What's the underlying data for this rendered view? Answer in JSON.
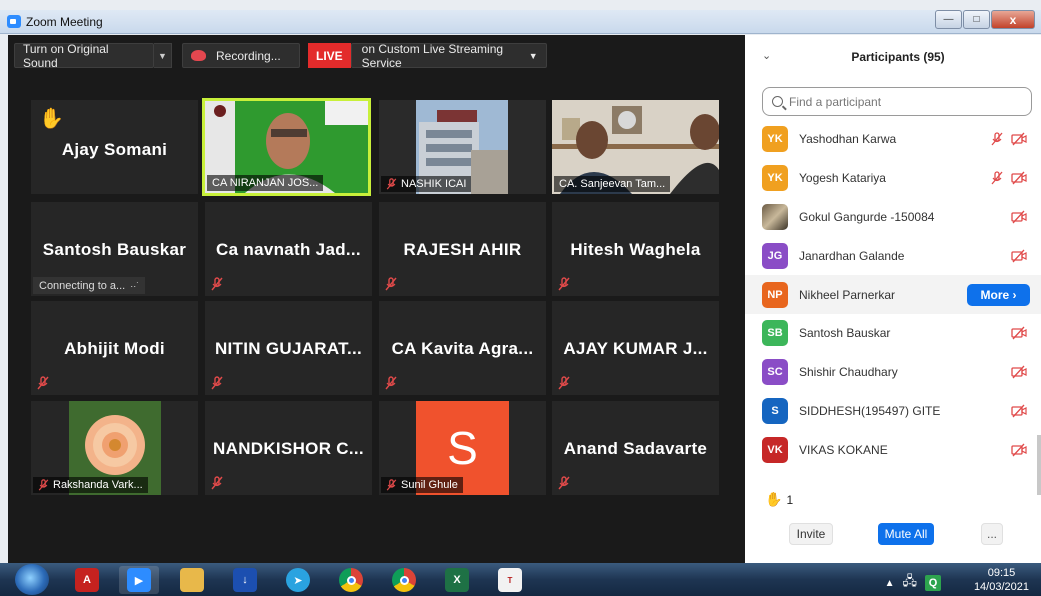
{
  "window": {
    "title": "Zoom Meeting"
  },
  "toolbar": {
    "original_sound": "Turn on Original Sound",
    "recording": "Recording...",
    "live": "LIVE",
    "stream": "on Custom Live Streaming Service"
  },
  "tiles": [
    {
      "name": "Ajay Somani",
      "hand_raised": true
    },
    {
      "label": "CA NIRANJAN JOS...",
      "video": true,
      "active_speaker": true
    },
    {
      "label": "NASHIK ICAI",
      "video": true,
      "muted": true
    },
    {
      "label": "CA. Sanjeevan Tam...",
      "video": true
    },
    {
      "name": "Santosh Bauskar",
      "status": "Connecting to a..."
    },
    {
      "name": "Ca navnath Jad...",
      "muted": true
    },
    {
      "name": "RAJESH AHIR",
      "muted": true
    },
    {
      "name": "Hitesh Waghela",
      "muted": true
    },
    {
      "name": "Abhijit Modi",
      "muted": true
    },
    {
      "name": "NITIN GUJARAT...",
      "muted": true
    },
    {
      "name": "CA Kavita Agra...",
      "muted": true
    },
    {
      "name": "AJAY KUMAR J...",
      "muted": true
    },
    {
      "label": "Rakshanda Vark...",
      "photo": true,
      "muted": true
    },
    {
      "name": "NANDKISHOR C...",
      "muted": true
    },
    {
      "label": "Sunil Ghule",
      "initial": "S",
      "muted": true
    },
    {
      "name": "Anand Sadavarte",
      "muted": true
    }
  ],
  "panel": {
    "title": "Participants (95)",
    "search_placeholder": "Find a participant",
    "participants": [
      {
        "initials": "YK",
        "name": "Yashodhan Karwa",
        "color": "#f0a020",
        "mic_muted": true,
        "video_off": true
      },
      {
        "initials": "YK",
        "name": "Yogesh Katariya",
        "color": "#f0a020",
        "mic_muted": true,
        "video_off": true
      },
      {
        "initials": "",
        "name": "Gokul Gangurde -150084",
        "photo": true,
        "video_off": true
      },
      {
        "initials": "JG",
        "name": "Janardhan Galande",
        "color": "#8a4dc6",
        "video_off": true
      },
      {
        "initials": "NP",
        "name": "Nikheel Parnerkar",
        "color": "#e8661e",
        "more": "More ›"
      },
      {
        "initials": "SB",
        "name": "Santosh Bauskar",
        "color": "#3cb65a",
        "video_off": true
      },
      {
        "initials": "SC",
        "name": "Shishir Chaudhary",
        "color": "#8a4dc6",
        "video_off": true
      },
      {
        "initials": "S",
        "name": "SIDDHESH(195497) GITE",
        "color": "#1565c0",
        "video_off": true
      },
      {
        "initials": "VK",
        "name": "VIKAS KOKANE",
        "color": "#c62828",
        "video_off": true
      }
    ],
    "raised_hands": "1",
    "invite": "Invite",
    "mute_all": "Mute All",
    "more_dots": "..."
  },
  "taskbar": {
    "apps": [
      "start-orb",
      "acrobat-app",
      "zoom-app",
      "file-explorer-app",
      "download-app",
      "telegram-app",
      "chrome-app",
      "chrome-app-2",
      "excel-app",
      "tally-erp-app"
    ],
    "time": "09:15",
    "date": "14/03/2021",
    "tray_q": "Q"
  },
  "colors": {
    "accent": "#0e71eb",
    "live": "#e32b2b",
    "active_border": "#c8f03a",
    "tile_bg": "#262626"
  }
}
